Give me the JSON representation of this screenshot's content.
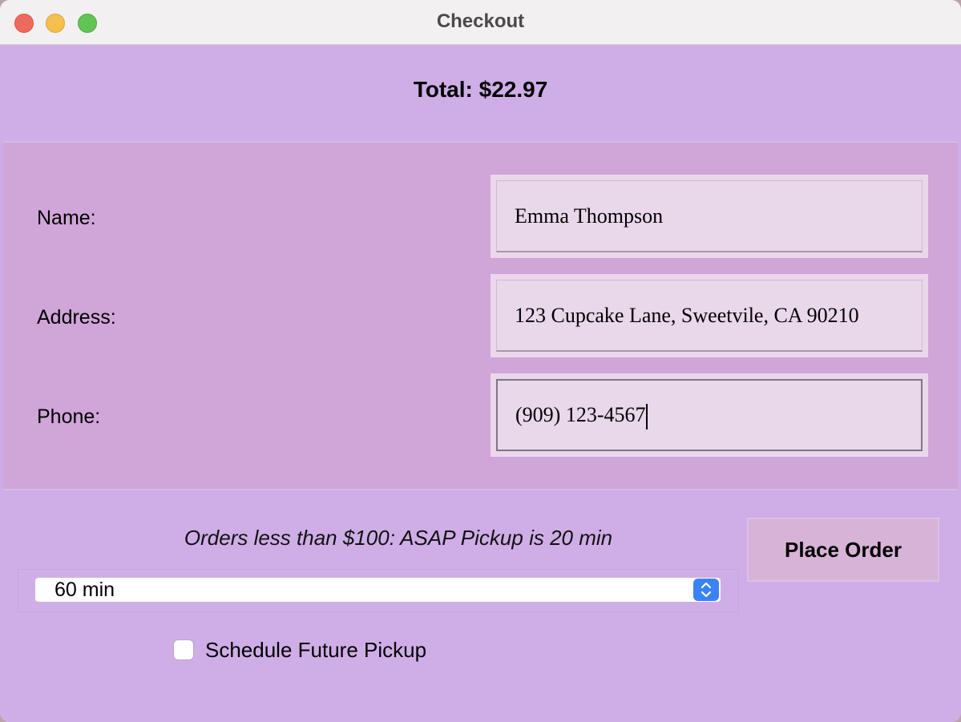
{
  "window": {
    "title": "Checkout"
  },
  "summary": {
    "total_label": "Total: $22.97"
  },
  "form": {
    "name_label": "Name:",
    "name_value": "Emma Thompson",
    "address_label": "Address:",
    "address_value": "123 Cupcake Lane, Sweetvile, CA 90210",
    "phone_label": "Phone:",
    "phone_value": "(909) 123-4567"
  },
  "pickup": {
    "notice": "Orders less than $100: ASAP Pickup is 20 min",
    "selected_time": "60 min",
    "schedule_label": "Schedule Future Pickup",
    "schedule_checked": false
  },
  "actions": {
    "place_order_label": "Place Order"
  },
  "icons": {
    "close": "close-icon",
    "minimize": "minimize-icon",
    "zoom": "zoom-icon",
    "stepper": "chevron-up-down-icon"
  },
  "colors": {
    "window_bg": "#cfaee7",
    "form_bg": "#d0a5d8",
    "input_bg": "#e9d7ea",
    "button_bg": "#d7b3d7",
    "stepper_blue": "#3b82f6"
  }
}
